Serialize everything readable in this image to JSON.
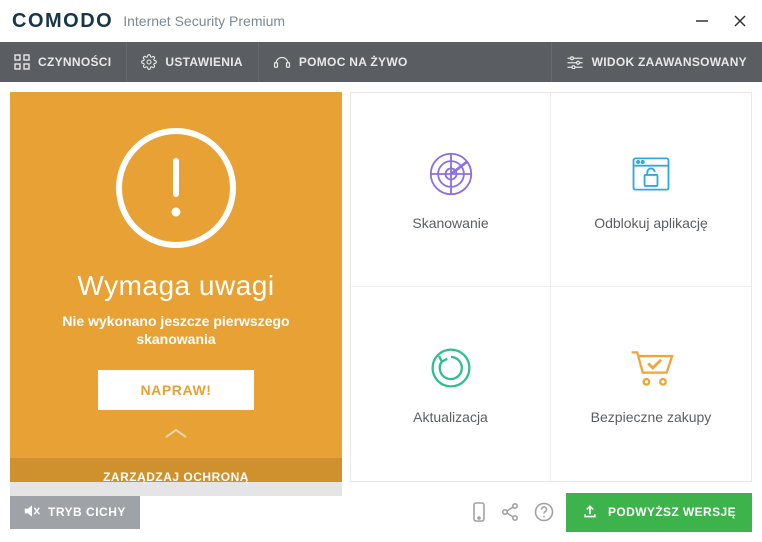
{
  "window": {
    "brand": "COMODO",
    "subtitle": "Internet Security Premium"
  },
  "menu": {
    "activities": "CZYNNOŚCI",
    "settings": "USTAWIENIA",
    "livehelp": "POMOC NA ŻYWO",
    "advanced": "WIDOK ZAAWANSOWANY"
  },
  "status": {
    "title": "Wymaga uwagi",
    "message": "Nie wykonano jeszcze pierwszego skanowania",
    "fix_label": "NAPRAW!",
    "manage_label": "ZARZĄDZAJ OCHRONĄ"
  },
  "tiles": {
    "scan": "Skanowanie",
    "unblock": "Odblokuj aplikację",
    "update": "Aktualizacja",
    "shopping": "Bezpieczne zakupy"
  },
  "footer": {
    "silent": "TRYB CICHY",
    "upgrade": "PODWYŻSZ WERSJĘ"
  },
  "colors": {
    "status_bg": "#E7A134",
    "upgrade_bg": "#3CB44B",
    "menubar_bg": "#5A5D61"
  }
}
